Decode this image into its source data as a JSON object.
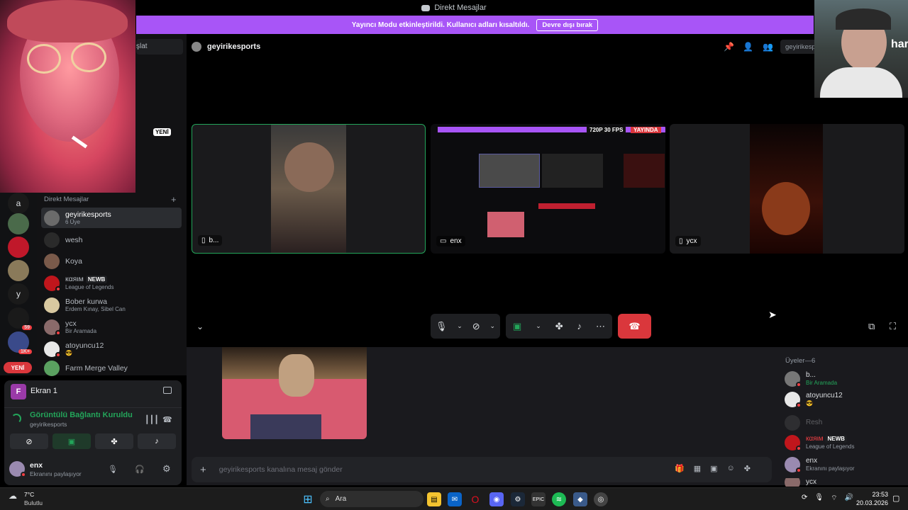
{
  "window": {
    "title": "Direkt Mesajlar"
  },
  "banner": {
    "text": "Yayıncı Modu etkinleştirildi. Kullanıcı adları kısaltıldı.",
    "button": "Devre dışı bırak"
  },
  "sidebar": {
    "search_fragment": "şlat",
    "new_badge": "YENİ",
    "section_title": "Direkt Mesajlar",
    "add_icon": "+",
    "server_letters": [
      "a",
      "y"
    ],
    "badges": {
      "count1": "59",
      "count2": "1K+",
      "new": "YENİ"
    }
  },
  "dms": [
    {
      "name": "geyirikesports",
      "sub": "6 Üye",
      "color": "#6b6b6b"
    },
    {
      "name": "wesh",
      "sub": "",
      "color": "#2a2a2a"
    },
    {
      "name": "Koya",
      "sub": "",
      "color": "#7a5a4a"
    },
    {
      "name": "кαяιм",
      "badge": "NEWB",
      "sub": "League of Legends",
      "color": "#c0161c"
    },
    {
      "name": "Bober kurwa",
      "sub": "Erdem Kınay, Sibel Can",
      "color": "#d8c8a0"
    },
    {
      "name": "ycx",
      "sub": "Bir Aramada",
      "color": "#8a6a6a"
    },
    {
      "name": "atoyuncu12",
      "sub": "😎",
      "color": "#e8e8e8"
    },
    {
      "name": "Farm Merge Valley",
      "sub": "",
      "color": "#5aa060"
    }
  ],
  "voice": {
    "stream_title": "Ekran 1",
    "stream_letter": "F",
    "status": "Görüntülü Bağlantı Kuruldu",
    "channel": "geyirikesports",
    "user": "enx",
    "user_status": "Ekranını paylaşıyor"
  },
  "channel": {
    "name": "geyirikesports",
    "header_fragment": "geyirikesp"
  },
  "tiles": [
    {
      "label": "b..."
    },
    {
      "label": "enx",
      "stream_tag": "720P 30 FPS",
      "live_tag": "YAYINDA"
    },
    {
      "label": "ycx"
    }
  ],
  "chat": {
    "placeholder": "geyirikesports kanalına mesaj gönder",
    "add": "+"
  },
  "members": {
    "header": "Üyeler—6",
    "list": [
      {
        "name": "b...",
        "sub": "Bir Aramada",
        "color": "#777"
      },
      {
        "name": "atoyuncu12",
        "sub": "😎",
        "color": "#e8e8e8"
      },
      {
        "name": "Resh",
        "sub": "",
        "color": "#555"
      },
      {
        "name": "кαяιм",
        "badge": "NEWB",
        "sub": "League of Legends",
        "color": "#c0161c"
      },
      {
        "name": "enx",
        "sub": "Ekranını paylaşıyor",
        "color": "#9a8ab0"
      },
      {
        "name": "ycx",
        "sub": "",
        "color": "#8a6a6a"
      }
    ]
  },
  "taskbar": {
    "weather_temp": "7°C",
    "weather_desc": "Bulutlu",
    "search": "Ara",
    "time": "23:53",
    "date": "20.03.2026"
  },
  "colors": {
    "accent": "#a855f7",
    "hangup": "#da373c",
    "online": "#23a55a"
  },
  "right_cam_text": "har"
}
